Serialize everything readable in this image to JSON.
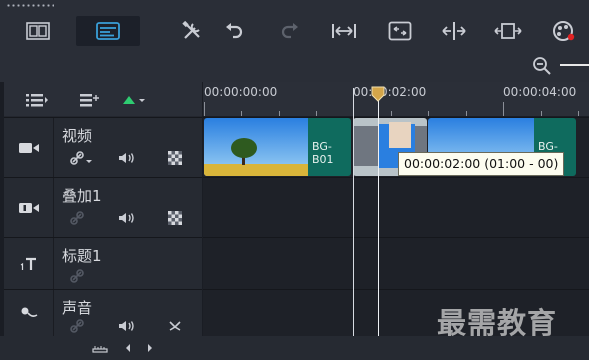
{
  "toolbar": {
    "buttons": [
      {
        "name": "storyboard-view-button",
        "icon": "film-strip-icon",
        "active": false
      },
      {
        "name": "timeline-view-button",
        "icon": "timeline-view-icon",
        "active": true
      },
      {
        "name": "tools-button",
        "icon": "tools-icon"
      },
      {
        "name": "undo-button",
        "icon": "undo-icon"
      },
      {
        "name": "redo-button",
        "icon": "redo-icon",
        "disabled": true
      },
      {
        "name": "fit-project-button",
        "icon": "fit-width-icon"
      },
      {
        "name": "trim-clip-button",
        "icon": "trim-icon"
      },
      {
        "name": "split-button",
        "icon": "split-icon"
      },
      {
        "name": "expand-button",
        "icon": "expand-icon"
      },
      {
        "name": "color-button",
        "icon": "palette-icon"
      }
    ]
  },
  "zoom": {
    "icon": "zoom-out-icon"
  },
  "ruler": {
    "ticks": [
      "00:00:00:00",
      "00:00:02:00",
      "00:00:04:00"
    ]
  },
  "tracks": [
    {
      "name": "视频",
      "type_icon": "video-camera-icon"
    },
    {
      "name": "叠加1",
      "type_icon": "overlay-1-icon"
    },
    {
      "name": "标题1",
      "type_icon": "title-icon"
    },
    {
      "name": "声音",
      "type_icon": "microphone-icon"
    }
  ],
  "clips": [
    {
      "label": "BG-B01"
    },
    {
      "label": "BG-B02"
    }
  ],
  "tooltip": "00:00:02:00 (01:00 - 00)",
  "watermark": "最需教育",
  "colors": {
    "accent": "#3a9fd8",
    "clip_label_bg": "#0f6b5e",
    "track_add": "#2ecc71"
  }
}
